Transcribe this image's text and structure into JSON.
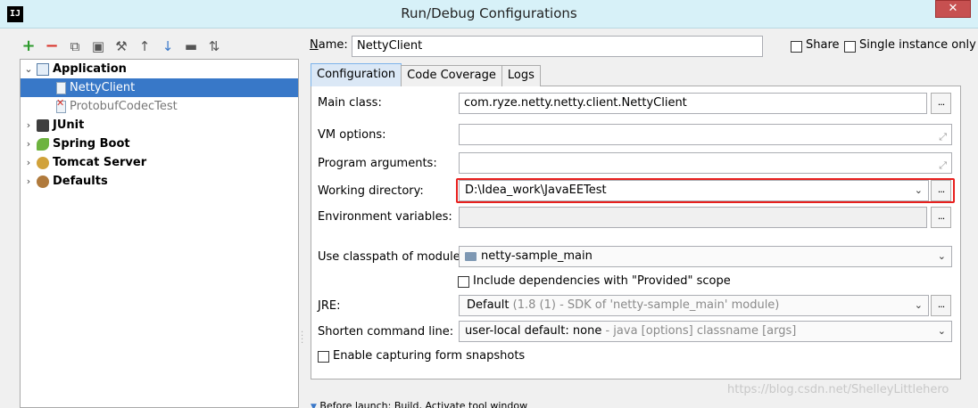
{
  "window": {
    "app_icon": "IJ",
    "title": "Run/Debug Configurations",
    "close_glyph": "✕"
  },
  "toolbar": {
    "icons": [
      "plus-icon",
      "minus-icon",
      "copy-icon",
      "save-icon",
      "wrench-icon",
      "arrow-up-icon",
      "arrow-down-icon",
      "folder-icon",
      "sort-alpha-icon"
    ]
  },
  "tree": {
    "items": [
      {
        "label": "Application",
        "expanded": true
      },
      {
        "label": "NettyClient",
        "selected": true
      },
      {
        "label": "ProtobufCodecTest",
        "error": true
      },
      {
        "label": "JUnit",
        "expanded": false
      },
      {
        "label": "Spring Boot",
        "expanded": false
      },
      {
        "label": "Tomcat Server",
        "expanded": false
      },
      {
        "label": "Defaults",
        "expanded": false
      }
    ]
  },
  "header": {
    "name_label": "Name:",
    "name_value": "NettyClient",
    "share_label": "Share",
    "single_instance_label": "Single instance only"
  },
  "tabs": [
    {
      "label": "Configuration",
      "active": true
    },
    {
      "label": "Code Coverage",
      "active": false
    },
    {
      "label": "Logs",
      "active": false
    }
  ],
  "form": {
    "main_class_label": "Main class:",
    "main_class_value": "com.ryze.netty.netty.client.NettyClient",
    "vm_options_label": "VM options:",
    "vm_options_value": "",
    "program_args_label": "Program arguments:",
    "program_args_value": "",
    "working_dir_label": "Working directory:",
    "working_dir_value": "D:\\Idea_work\\JavaEETest",
    "env_vars_label": "Environment variables:",
    "env_vars_value": "",
    "classpath_label": "Use classpath of module:",
    "classpath_value": "netty-sample_main",
    "include_deps_label": "Include dependencies with \"Provided\" scope",
    "jre_label": "JRE:",
    "jre_value_main": "Default",
    "jre_value_detail": "(1.8 (1) - SDK of 'netty-sample_main' module)",
    "shorten_label": "Shorten command line:",
    "shorten_value_main": "user-local default: none",
    "shorten_value_detail": "- java [options] classname [args]",
    "capture_label": "Enable capturing form snapshots",
    "dots": "..."
  },
  "before_launch": "Before launch: Build, Activate tool window",
  "watermark": "https://blog.csdn.net/ShelleyLittlehero"
}
